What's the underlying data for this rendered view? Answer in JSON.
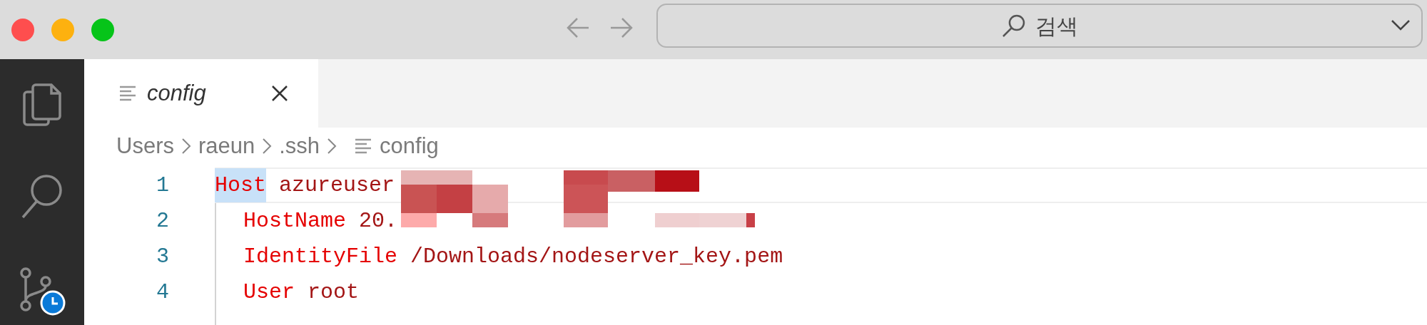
{
  "window": {
    "search": {
      "placeholder": "검색"
    }
  },
  "tabs": [
    {
      "label": "config",
      "selected": true
    }
  ],
  "breadcrumb": [
    "Users",
    "raeun",
    ".ssh",
    "config"
  ],
  "lines": [
    {
      "number": "1",
      "kind": "host",
      "key": "Host",
      "value": "azureuser",
      "current": true,
      "key_highlighted": true
    },
    {
      "number": "2",
      "kind": "option",
      "key": "HostName",
      "value": "20.",
      "current": false,
      "key_highlighted": false
    },
    {
      "number": "3",
      "kind": "option",
      "key": "IdentityFile",
      "value": "/Downloads/nodeserver_key.pem",
      "current": false,
      "key_highlighted": false
    },
    {
      "number": "4",
      "kind": "option",
      "key": "User",
      "value": "root",
      "current": false,
      "key_highlighted": false
    }
  ]
}
